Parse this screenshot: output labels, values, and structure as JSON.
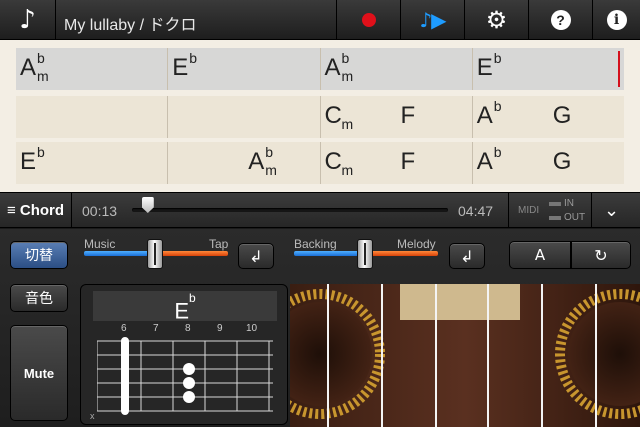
{
  "topbar": {
    "note_icon": "♪",
    "song_title": "My lullaby / ドクロ",
    "record_icon": "record-icon",
    "play_icon": "♪▶",
    "settings_icon": "⚙",
    "help_icon": "?",
    "info_icon": "i"
  },
  "sheet": {
    "rows": [
      {
        "current": true,
        "cells": [
          {
            "root": "A",
            "acc": "b",
            "quality": "m"
          },
          {
            "root": "E",
            "acc": "b",
            "quality": ""
          },
          {
            "root": "A",
            "acc": "b",
            "quality": "m"
          },
          {
            "root": "E",
            "acc": "b",
            "quality": ""
          }
        ]
      },
      {
        "current": false,
        "cells": [
          {
            "root": "",
            "acc": "",
            "quality": ""
          },
          {
            "root": "",
            "acc": "",
            "quality": ""
          },
          {
            "root": "C",
            "acc": "",
            "quality": "m",
            "second": "F"
          },
          {
            "root": "A",
            "acc": "b",
            "quality": "",
            "second": "G"
          }
        ]
      },
      {
        "current": false,
        "cells": [
          {
            "root": "E",
            "acc": "b",
            "quality": ""
          },
          {
            "root": "A",
            "acc": "b",
            "quality": "m"
          },
          {
            "root": "C",
            "acc": "",
            "quality": "m",
            "second": "F"
          },
          {
            "root": "A",
            "acc": "b",
            "quality": "",
            "second": "G"
          }
        ]
      }
    ]
  },
  "timeline": {
    "chord_tab_label": "≡ Chord",
    "current_time": "00:13",
    "total_time": "04:47",
    "progress": 0.05,
    "midi_label": "MIDI",
    "midi_in": "IN",
    "midi_out": "OUT",
    "expand_icon": "⌄"
  },
  "controls": {
    "switch_label": "切替",
    "tone_label": "音色",
    "mute_label": "Mute",
    "mixer1": {
      "left_label": "Music",
      "right_label": "Tap",
      "level": 0.5
    },
    "mixer2": {
      "left_label": "Backing",
      "right_label": "Melody",
      "level": 0.5
    },
    "reset_icon": "↲",
    "key_label": "A",
    "refresh_icon": "↻"
  },
  "diagram": {
    "chord_root": "E",
    "chord_acc": "b",
    "fret_numbers": [
      "6",
      "7",
      "8",
      "9",
      "10"
    ],
    "muted_string": "x"
  },
  "colors": {
    "accent_blue": "#1e9cff",
    "record_red": "#e0101a",
    "slider_blue": "#2a8cf0",
    "slider_orange": "#ee5a1a"
  }
}
